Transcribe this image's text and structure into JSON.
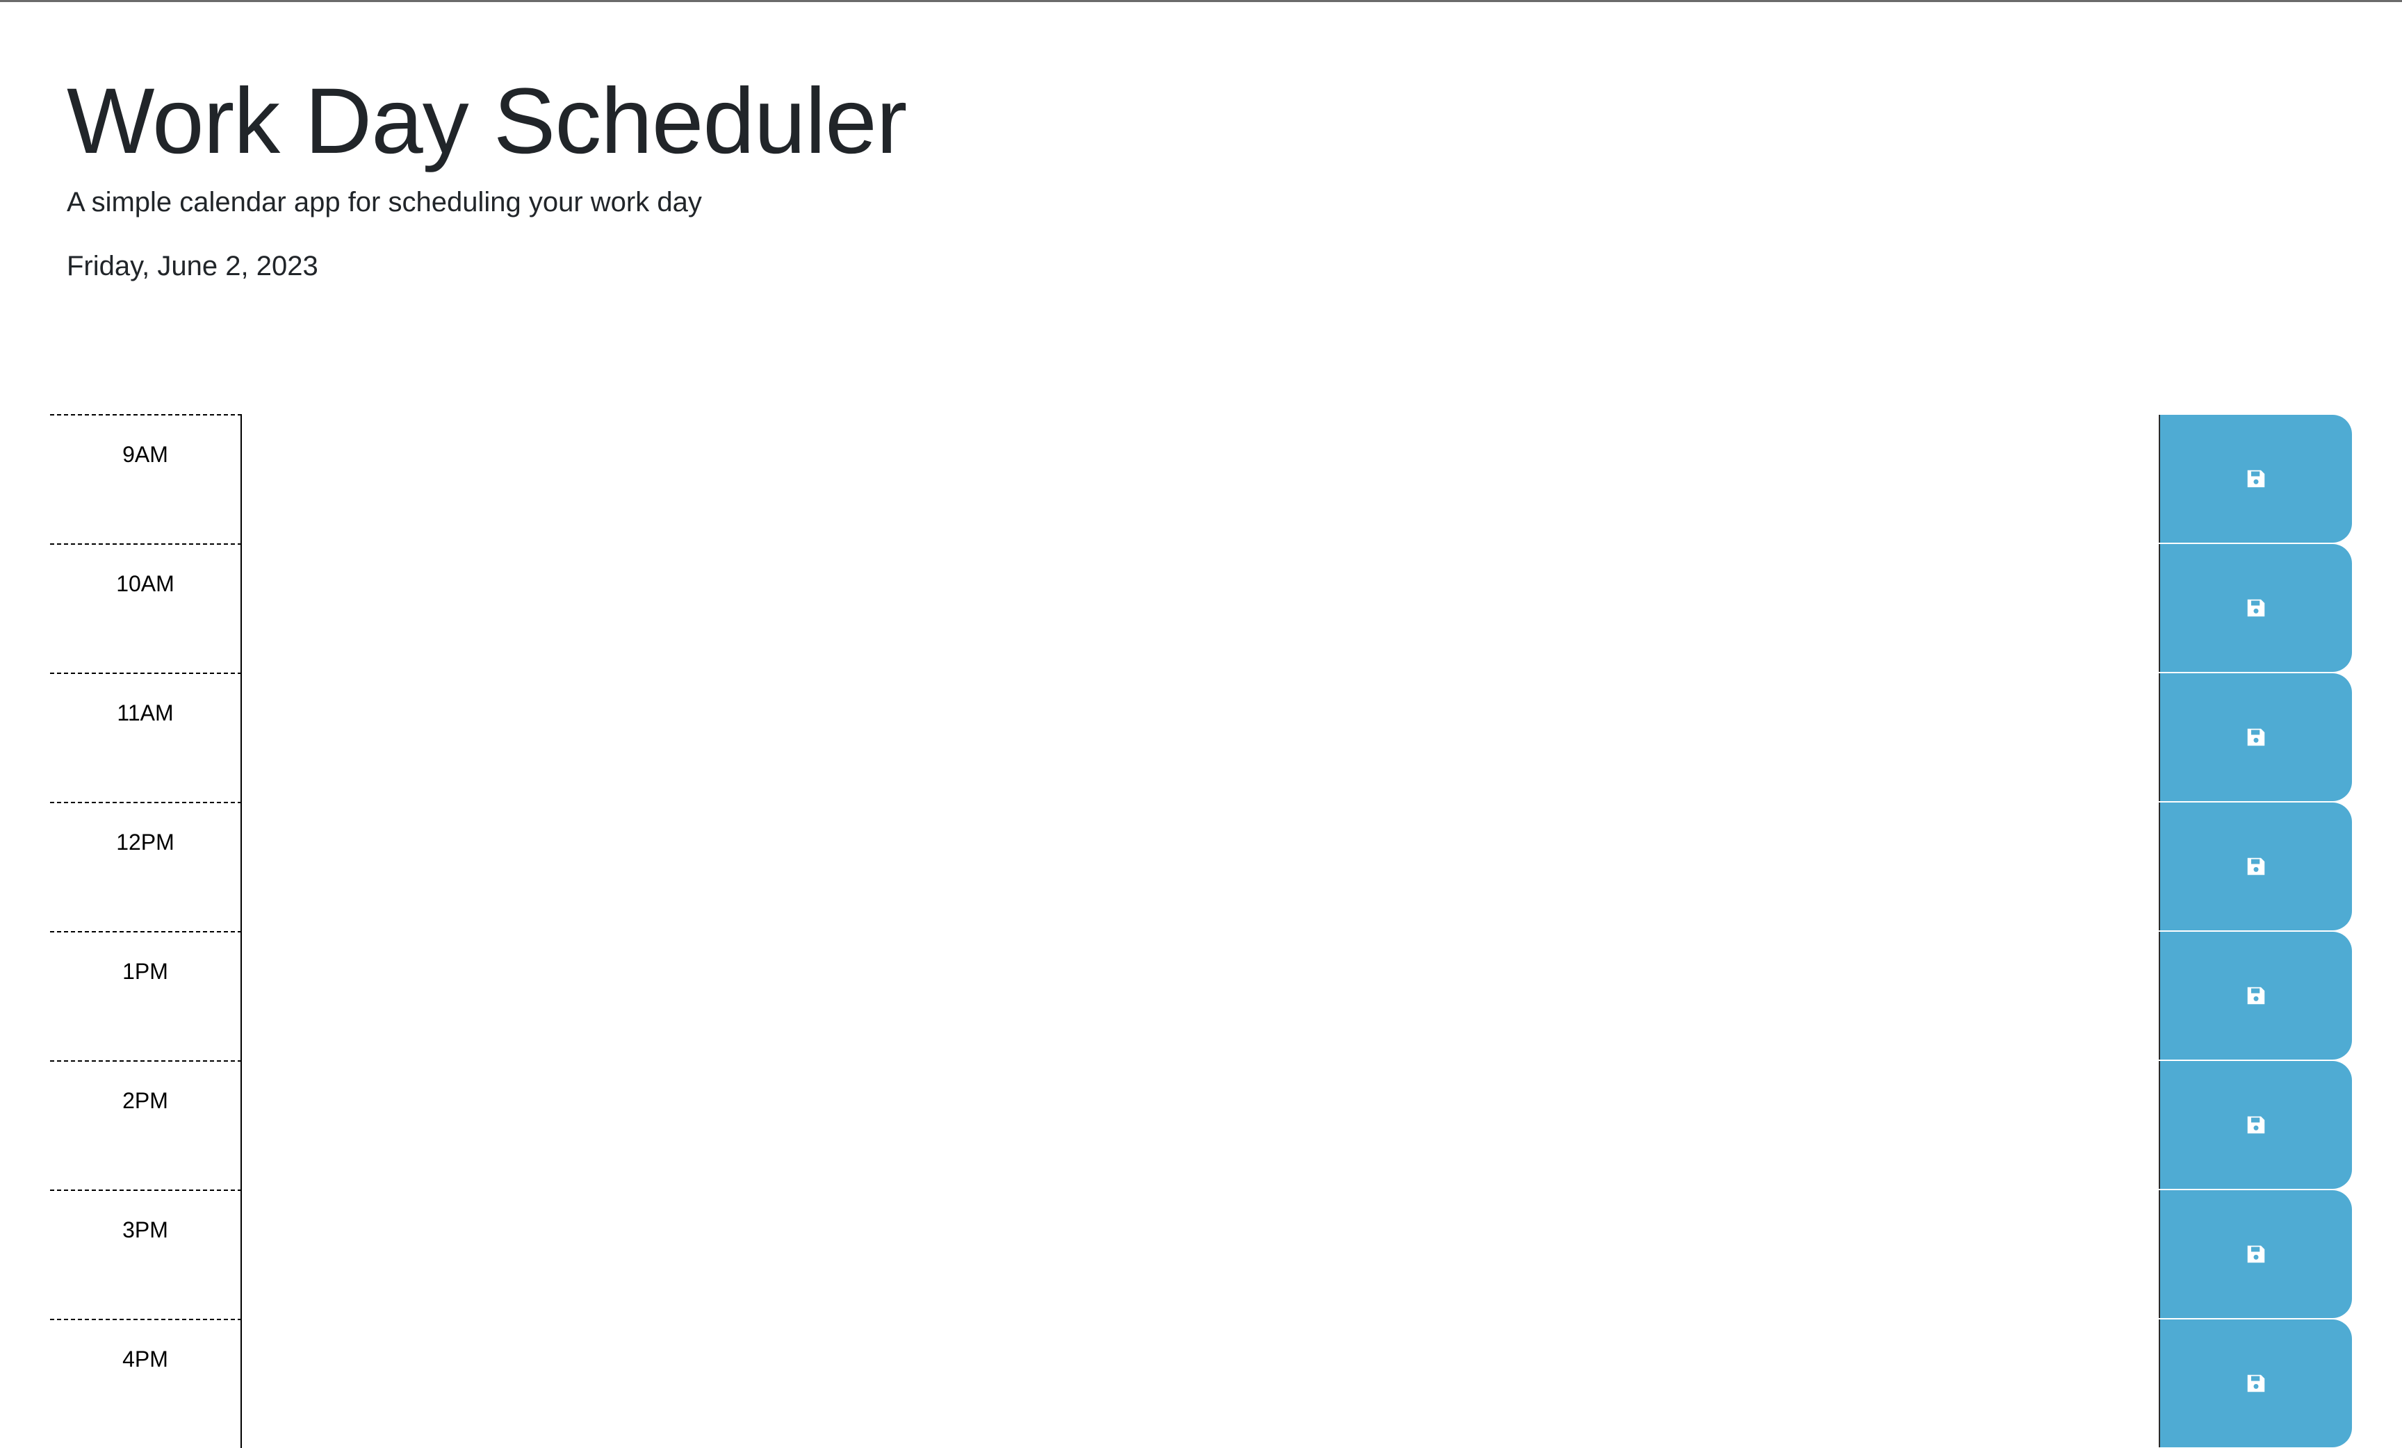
{
  "header": {
    "title": "Work Day Scheduler",
    "subtitle": "A simple calendar app for scheduling your work day",
    "current_date": "Friday, June 2, 2023"
  },
  "colors": {
    "save_button": "#4fabd3",
    "text": "#212529"
  },
  "rows": [
    {
      "hour": "9AM",
      "text": "",
      "icon": "save-icon"
    },
    {
      "hour": "10AM",
      "text": "",
      "icon": "save-icon"
    },
    {
      "hour": "11AM",
      "text": "",
      "icon": "save-icon"
    },
    {
      "hour": "12PM",
      "text": "",
      "icon": "save-icon"
    },
    {
      "hour": "1PM",
      "text": "",
      "icon": "save-icon"
    },
    {
      "hour": "2PM",
      "text": "",
      "icon": "save-icon"
    },
    {
      "hour": "3PM",
      "text": "",
      "icon": "save-icon"
    },
    {
      "hour": "4PM",
      "text": "",
      "icon": "save-icon"
    }
  ]
}
